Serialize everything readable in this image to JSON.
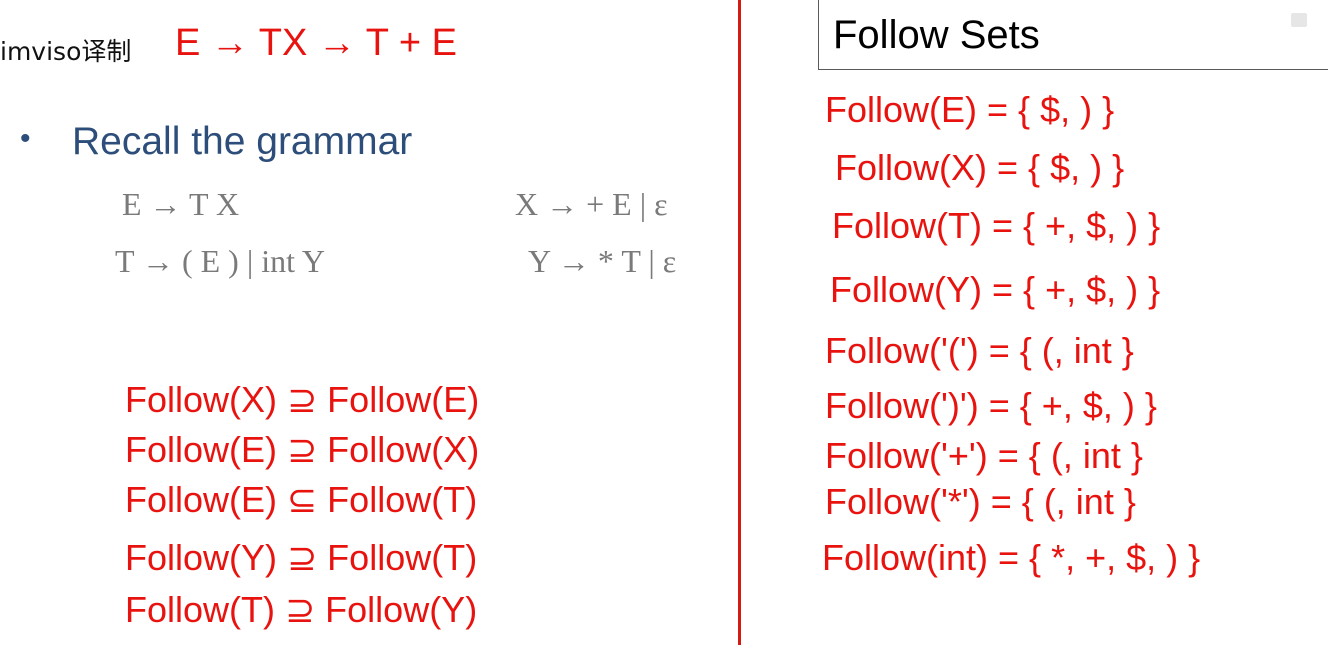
{
  "watermark": {
    "text": "imviso译制"
  },
  "top_note": {
    "text": "E → TX → T + E"
  },
  "slide": {
    "bullet": "•",
    "recall_text": "Recall the grammar",
    "grammar": [
      "E → T X",
      "X → + E | ε",
      "T → ( E ) | int Y",
      "Y → * T | ε"
    ]
  },
  "left_notes": [
    "Follow(X) ⊇ Follow(E)",
    "Follow(E) ⊇ Follow(X)",
    "Follow(E) ⊆ Follow(T)",
    "Follow(Y) ⊇ Follow(T)",
    "Follow(T) ⊇ Follow(Y)"
  ],
  "right_panel": {
    "title": "Follow Sets",
    "rows": [
      "Follow(E) = { $, ) }",
      "Follow(X) = { $, ) }",
      "Follow(T) = { +, $, ) }",
      "Follow(Y) = { +, $, ) }",
      "Follow('(') = { (, int }",
      "Follow(')') = { +, $, ) }",
      "Follow('+') = { (, int }",
      "Follow('*') = { (, int }",
      "Follow(int) = { *, +, $, ) }"
    ]
  },
  "colors": {
    "ink": "#e8130f",
    "slide_text": "#2d4e7a",
    "grammar_text": "#7a7a7a"
  }
}
